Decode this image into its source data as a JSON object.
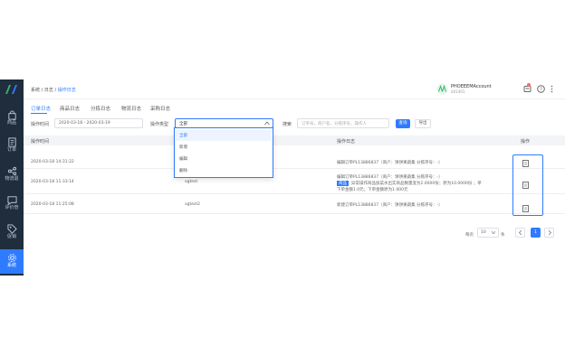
{
  "sidebar": {
    "items": [
      {
        "label": "商品",
        "icon": "bag-icon"
      },
      {
        "label": "订单",
        "icon": "document-icon"
      },
      {
        "label": "物流退",
        "icon": "share-icon"
      },
      {
        "label": "评价管",
        "icon": "message-icon"
      },
      {
        "label": "促销",
        "icon": "tag-icon"
      },
      {
        "label": "系统",
        "icon": "gear-icon"
      }
    ]
  },
  "breadcrumb": {
    "root": "系统",
    "mid": "日志",
    "current": "操作日志"
  },
  "user": {
    "name": "PHOEEEMAccount",
    "code": "SX1401"
  },
  "tabs": [
    "订单日志",
    "商品日志",
    "分拣日志",
    "物流日志",
    "采购日志"
  ],
  "filters": {
    "time_label": "操作时间",
    "date_range": "2020-03-18 - 2020-03-19",
    "type_label": "操作类型",
    "type_value": "全部",
    "search_label": "搜索",
    "search_placeholder": "订单号，商户名，分拣序号，操作人",
    "search_button": "查询",
    "export_button": "导出"
  },
  "type_options": [
    "全部",
    "新增",
    "编辑",
    "删除"
  ],
  "table": {
    "headers": {
      "time": "操作时间",
      "detail": "操作日志",
      "action": "操作"
    },
    "rows": [
      {
        "time": "2020-03-18 14:31:22",
        "operator": "",
        "detail_lines": [
          "编辑订单PL13886837（商户：饼饼果蔬集   分拣序号：-）"
        ]
      },
      {
        "time": "2020-03-18 11:33:14",
        "operator": "xgtest",
        "detail_lines": [
          "编辑订单PL13886837（商户：饼饼果蔬集   分拣序号：-）",
          "异常操作商品加菜水出实商品数量变为2.0000份；原为10.0000份 ；单",
          "下单金额1.0元；下单金额原为1.000元"
        ],
        "highlight": "商品"
      },
      {
        "time": "2020-03-18 11:25:08",
        "operator": "xgtest2",
        "detail_lines": [
          "新建订单PL13886837（商户：饼饼果蔬集   分拣序号：-）"
        ]
      }
    ]
  },
  "pager": {
    "per_page_label": "每页",
    "per_page_value": "10",
    "unit": "条",
    "current_page": "1"
  }
}
